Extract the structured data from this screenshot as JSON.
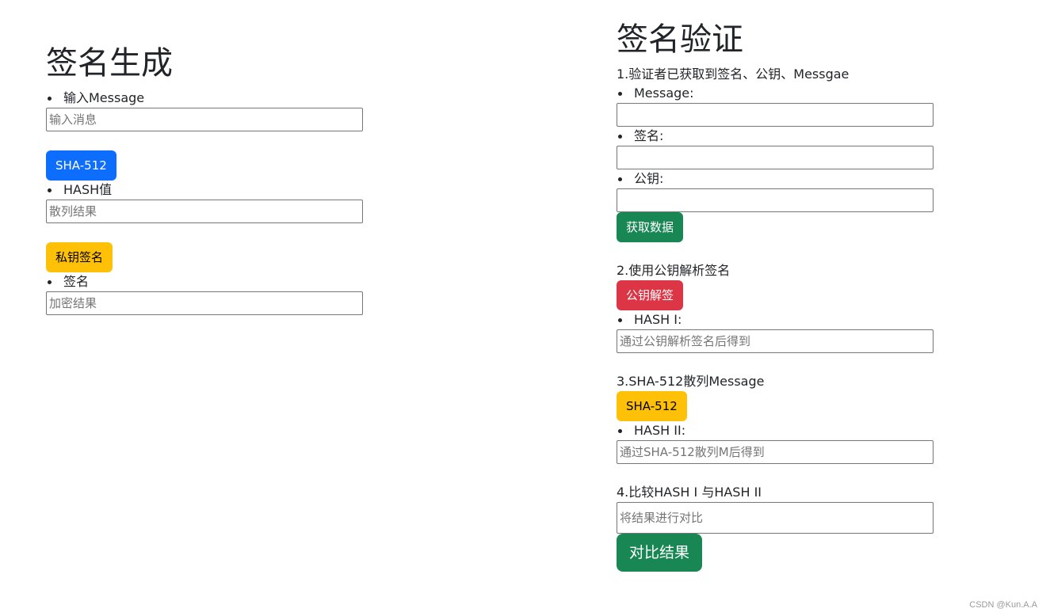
{
  "left": {
    "title": "签名生成",
    "message_label": "输入Message",
    "message_placeholder": "输入消息",
    "sha_button": "SHA-512",
    "hash_label": "HASH值",
    "hash_placeholder": "散列结果",
    "sign_button": "私钥签名",
    "signature_label": "签名",
    "signature_placeholder": "加密结果"
  },
  "right": {
    "title": "签名验证",
    "step1_text": "1.验证者已获取到签名、公钥、Messgae",
    "message_label": "Message:",
    "signature_label": "签名:",
    "pubkey_label": "公钥:",
    "fetch_button": "获取数据",
    "step2_text": "2.使用公钥解析签名",
    "decrypt_button": "公钥解签",
    "hash1_label": "HASH I:",
    "hash1_placeholder": "通过公钥解析签名后得到",
    "step3_text": "3.SHA-512散列Message",
    "sha_button": "SHA-512",
    "hash2_label": "HASH II:",
    "hash2_placeholder": "通过SHA-512散列M后得到",
    "step4_text": "4.比较HASH I 与HASH II",
    "compare_placeholder": "将结果进行对比",
    "compare_button": "对比结果"
  },
  "watermark": "CSDN @Kun.A.A",
  "colors": {
    "primary": "#0d6efd",
    "warning": "#ffc107",
    "success": "#198754",
    "danger": "#dc3545"
  }
}
